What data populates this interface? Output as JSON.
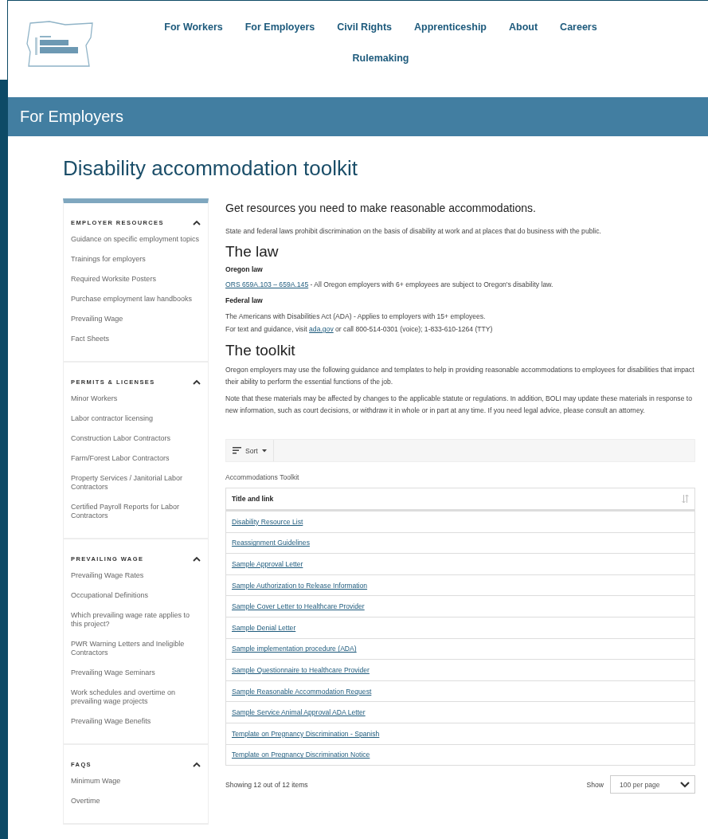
{
  "header": {
    "nav": [
      {
        "label": "For Workers"
      },
      {
        "label": "For Employers"
      },
      {
        "label": "Civil Rights"
      },
      {
        "label": "Apprenticeship"
      },
      {
        "label": "About"
      },
      {
        "label": "Careers"
      },
      {
        "label": "Rulemaking"
      }
    ]
  },
  "banner": {
    "title": "For Employers"
  },
  "page_title": "Disability accommodation toolkit",
  "sidebar": {
    "sections": [
      {
        "heading": "EMPLOYER RESOURCES",
        "expanded": true,
        "items": [
          "Guidance on specific employment topics",
          "Trainings for employers",
          "Required Worksite Posters",
          "Purchase employment law handbooks",
          "Prevailing Wage",
          "Fact Sheets"
        ]
      },
      {
        "heading": "PERMITS & LICENSES",
        "expanded": true,
        "items": [
          "Minor Workers",
          "Labor contractor licensing",
          "Construction Labor Contractors",
          "Farm/Forest Labor Contractors",
          "Property Services / Janitorial Labor Contractors",
          "Certified Payroll Reports for Labor Contractors"
        ]
      },
      {
        "heading": "PREVAILING WAGE",
        "expanded": true,
        "items": [
          "Prevailing Wage Rates",
          "Occupational Definitions",
          "Which prevailing wage rate applies to this project?",
          "PWR Warning Letters and Ineligible Contractors",
          "Prevailing Wage Seminars",
          "Work schedules and overtime on prevailing wage projects",
          "Prevailing Wage Benefits"
        ]
      },
      {
        "heading": "FAQS",
        "expanded": true,
        "items": [
          "Minimum Wage",
          "Overtime"
        ]
      }
    ]
  },
  "main": {
    "lead": "Get resources you need to make reasonable accommodations.",
    "intro": "State and federal laws prohibit discrimination on the basis of disability at work and at places that do business with the public.",
    "law": {
      "heading": "The law",
      "oregon_heading": "Oregon law",
      "oregon_link": "ORS 659A.103 – 659A.145",
      "oregon_text": " - All Oregon employers with 6+ employees are subject to Oregon's disability law.",
      "federal_heading": "Federal law",
      "federal_text": "The Americans with Disabilities Act (ADA) - Applies to employers with 15+ employees.",
      "guidance_before": "For text and guidance, visit ",
      "guidance_link": "ada.gov",
      "guidance_after": " or call 800-514-0301 (voice); 1-833-610-1264 (TTY)"
    },
    "toolkit": {
      "heading": "The toolkit",
      "paragraphs": [
        "Oregon employers may use the following guidance and templates to help in providing reasonable accommodations to employees for disabilities that impact their ability to perform the essential functions of the job.",
        "Note that these materials may be affected by changes to the applicable statute or regulations. In addition, BOLI may update these materials in response to new information, such as court decisions, or withdraw it in whole or in part at any time. If you need legal advice, please consult an attorney."
      ]
    },
    "sort_button": "Sort",
    "table": {
      "caption": "Accommodations Toolkit",
      "columns": [
        "Title and link"
      ],
      "rows": [
        "Disability Resource List",
        "Reassignment Guidelines",
        "Sample Approval Letter",
        "Sample Authorization to Release Information",
        "Sample Cover Letter to Healthcare Provider",
        "Sample Denial Letter",
        "Sample implementation procedure (ADA)",
        "Sample Questionnaire to Healthcare Provider",
        "Sample Reasonable Accommodation Request",
        "Sample Service Animal Approval ADA Letter",
        "Template on Pregnancy Discrimination - Spanish",
        "Template on Pregnancy Discrimination Notice"
      ]
    },
    "footer": {
      "count": "Showing 12 out of 12 items",
      "show_label": "Show",
      "per_page": "100 per page"
    }
  }
}
